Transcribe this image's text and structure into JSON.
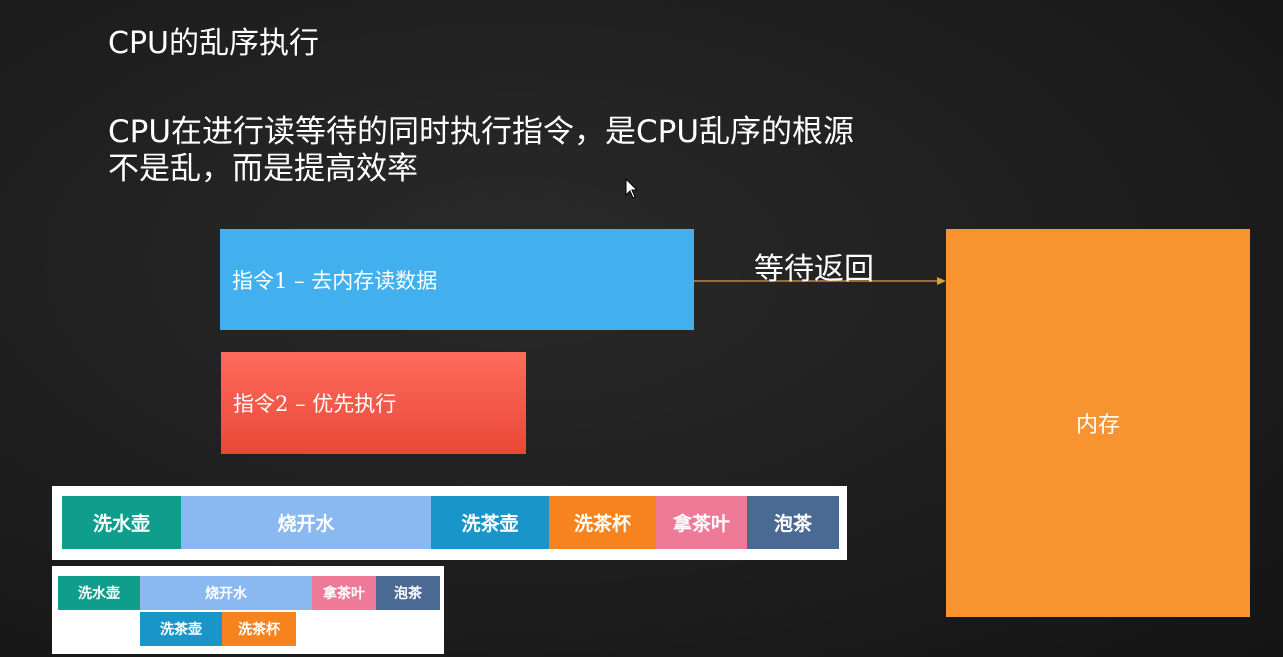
{
  "slide": {
    "title": "CPU的乱序执行",
    "text_line_1": "CPU在进行读等待的同时执行指令，是CPU乱序的根源",
    "text_line_2": "不是乱，而是提高效率"
  },
  "diagram": {
    "instruction_1": "指令1 – 去内存读数据",
    "instruction_2": "指令2 – 优先执行",
    "wait_label": "等待返回",
    "memory_label": "内存"
  },
  "timeline_sequential": {
    "steps": [
      "洗水壶",
      "烧开水",
      "洗茶壶",
      "洗茶杯",
      "拿茶叶",
      "泡茶"
    ]
  },
  "timeline_parallel": {
    "top_row": [
      "洗水壶",
      "烧开水",
      "拿茶叶",
      "泡茶"
    ],
    "bottom_row": [
      "洗茶壶",
      "洗茶杯"
    ]
  },
  "colors": {
    "instruction_1": "#42b0ee",
    "instruction_2": "#e84838",
    "memory": "#f7942f",
    "wash_kettle": "#0f9d8c",
    "boil_water": "#8ab8f0",
    "wash_teapot": "#1a95c9",
    "wash_cup": "#f7831e",
    "get_tea": "#ef7a98",
    "brew_tea": "#4a6a94"
  }
}
